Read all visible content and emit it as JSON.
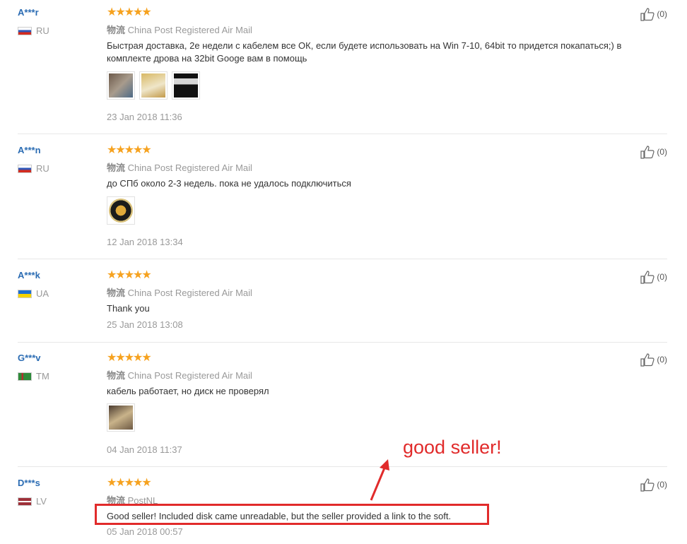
{
  "reviews": [
    {
      "user": "A***r",
      "country": "RU",
      "stars": "★★★★★",
      "shipping_label": "物流",
      "shipping_method": "China Post Registered Air Mail",
      "text": "Быстрая доставка, 2е недели с кабелем все ОК, если будете использовать на Win 7-10, 64bit то придется покапаться;) в комплекте дрова на 32bit Googe вам в помощь",
      "date": "23 Jan 2018 11:36",
      "likes": "(0)"
    },
    {
      "user": "A***n",
      "country": "RU",
      "stars": "★★★★★",
      "shipping_label": "物流",
      "shipping_method": "China Post Registered Air Mail",
      "text": "до СПб около 2-3 недель. пока не удалось подключиться",
      "date": "12 Jan 2018 13:34",
      "likes": "(0)"
    },
    {
      "user": "A***k",
      "country": "UA",
      "stars": "★★★★★",
      "shipping_label": "物流",
      "shipping_method": "China Post Registered Air Mail",
      "text": "Thank you",
      "date": "25 Jan 2018 13:08",
      "likes": "(0)"
    },
    {
      "user": "G***v",
      "country": "TM",
      "stars": "★★★★★",
      "shipping_label": "物流",
      "shipping_method": "China Post Registered Air Mail",
      "text": "кабель работает, но диск не проверял",
      "date": "04 Jan 2018 11:37",
      "likes": "(0)"
    },
    {
      "user": "D***s",
      "country": "LV",
      "stars": "★★★★★",
      "shipping_label": "物流",
      "shipping_method": "PostNL",
      "text": "Good seller! Included disk came unreadable, but the seller provided a link to the soft.",
      "date": "05 Jan 2018 00:57",
      "likes": "(0)"
    }
  ],
  "annotation": {
    "text": "good seller!",
    "color": "#e12b2b"
  },
  "colors": {
    "username": "#2b6cb3",
    "stars": "#f6a21f",
    "muted": "#999999"
  }
}
